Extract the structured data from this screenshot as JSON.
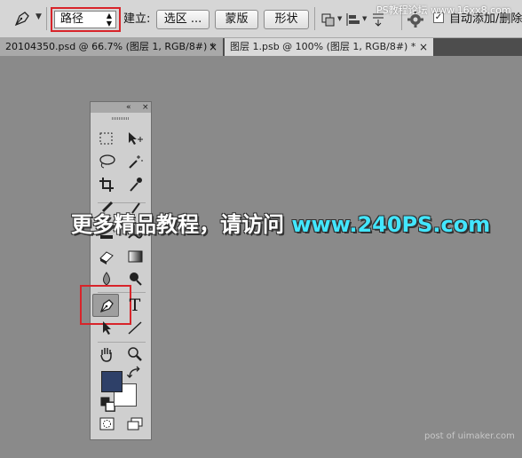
{
  "options_bar": {
    "tool_icon": "pen-icon",
    "mode_select": {
      "value": "路径",
      "options_visible": [
        "路径"
      ]
    },
    "make_label": "建立:",
    "selection_button": "选区 ...",
    "mask_button": "蒙版",
    "shape_button": "形状",
    "path_ops_icon": "path-operations-icon",
    "path_align_icon": "path-alignment-icon",
    "path_arrange_icon": "path-arrangement-icon",
    "settings_icon": "gear-icon",
    "auto_add_delete": {
      "label": "自动添加/删除",
      "checked": true
    }
  },
  "watermark_top": "PS教程论坛 www.16xx8.com",
  "tabs": [
    {
      "label": "20104350.psd @ 66.7% (图层 1, RGB/8#) *",
      "active": false
    },
    {
      "label": "图层 1.psb @ 100% (图层 1, RGB/8#) *",
      "active": true
    }
  ],
  "tools_panel": {
    "collapse_icon": "«",
    "close_icon": "×",
    "selected_tool": "pen-tool",
    "type_tool_glyph": "T",
    "foreground_color": "#2e4068",
    "background_color": "#ffffff"
  },
  "overlay": {
    "tutorial_text": "更多精品教程，请访问 ",
    "tutorial_url": "www.240PS.com",
    "footer": "post of uimaker.com"
  },
  "colors": {
    "highlight_red": "#d8242a",
    "url_cyan": "#43e6ff"
  }
}
